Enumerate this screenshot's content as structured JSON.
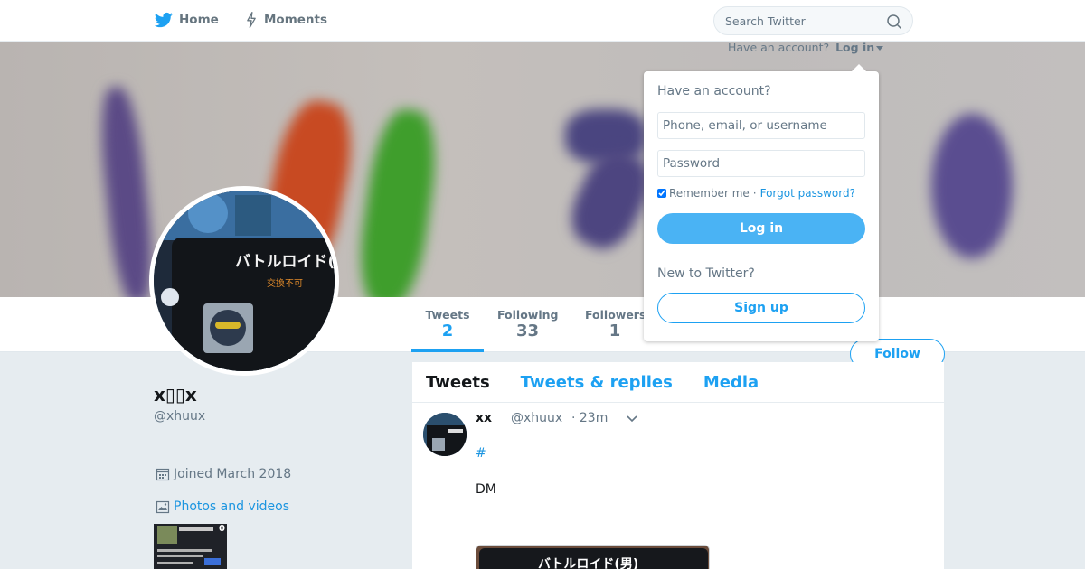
{
  "nav": {
    "home_label": "Home",
    "moments_label": "Moments",
    "search_placeholder": "Search Twitter"
  },
  "login_bar": {
    "have_account": "Have an account?",
    "login_label": "Log in"
  },
  "login_dropdown": {
    "heading": "Have an account?",
    "phone_placeholder": "Phone, email, or username",
    "password_placeholder": "Password",
    "remember_me": "Remember me",
    "separator": "·",
    "forgot_password": "Forgot password?",
    "login_button": "Log in",
    "new_to_twitter": "New to Twitter?",
    "signup_button": "Sign up"
  },
  "stats": [
    {
      "label": "Tweets",
      "value": "2",
      "active": true
    },
    {
      "label": "Following",
      "value": "33",
      "active": false
    },
    {
      "label": "Followers",
      "value": "1",
      "active": false
    }
  ],
  "follow_button": "Follow",
  "profile": {
    "name": "x▯▯x",
    "handle": "@xhuux",
    "joined": "Joined March 2018",
    "photos_label": "Photos and videos",
    "thumb_badge": "0"
  },
  "avatar_text": {
    "line1": "バトルロイド(男",
    "line2": "交換不可"
  },
  "timeline": {
    "tabs": [
      "Tweets",
      "Tweets & replies",
      "Media"
    ],
    "tweet": {
      "name": "xx",
      "handle": "@xhuux",
      "time": "· 23m",
      "hashtag": "#",
      "text": "DM",
      "media_text": "バトルロイド(男)"
    }
  },
  "colors": {
    "accent": "#1da1f2",
    "login_button": "#4ab3f4",
    "background": "#e6ecf0",
    "secondary_text": "#657786"
  },
  "icons": {
    "home": "twitter-bird-icon",
    "moments": "lightning-icon",
    "search": "search-icon",
    "calendar": "calendar-icon",
    "photo": "photo-icon",
    "caret": "chevron-down-icon"
  }
}
